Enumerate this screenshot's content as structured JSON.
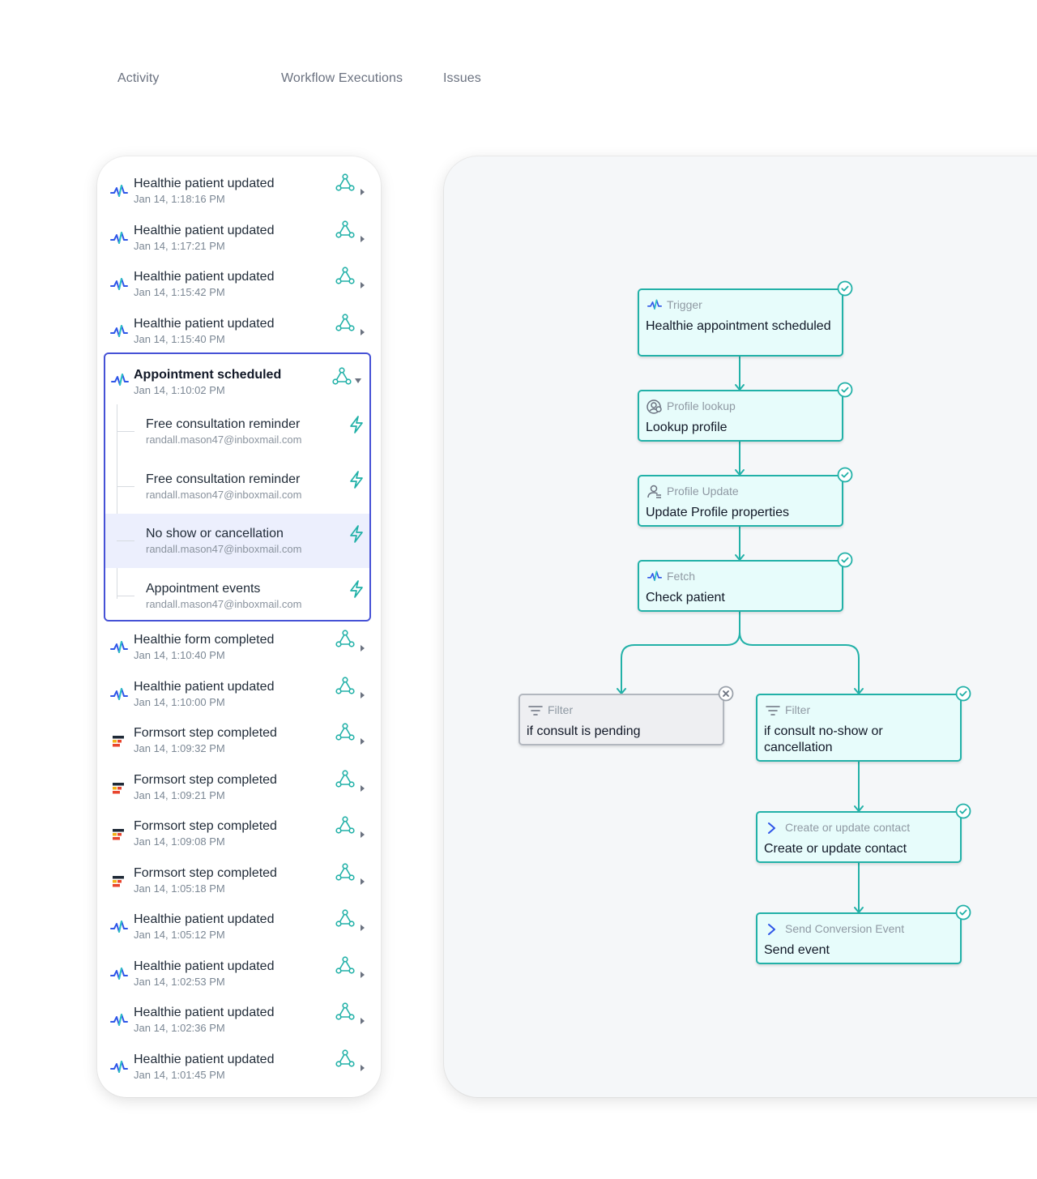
{
  "tabs": [
    {
      "label": "Activity"
    },
    {
      "label": "Workflow Executions"
    },
    {
      "label": "Issues"
    }
  ],
  "activity": {
    "top_items": [
      {
        "title": "Healthie patient updated",
        "time": "Jan 14, 1:18:16 PM",
        "source": "healthie"
      },
      {
        "title": "Healthie patient updated",
        "time": "Jan 14, 1:17:21 PM",
        "source": "healthie"
      },
      {
        "title": "Healthie patient updated",
        "time": "Jan 14, 1:15:42 PM",
        "source": "healthie"
      },
      {
        "title": "Healthie patient updated",
        "time": "Jan 14, 1:15:40 PM",
        "source": "healthie"
      }
    ],
    "expanded": {
      "title": "Appointment scheduled",
      "time": "Jan 14, 1:10:02 PM",
      "source": "healthie",
      "children": [
        {
          "title": "Free consultation reminder",
          "email": "randall.mason47@inboxmail.com",
          "selected": false
        },
        {
          "title": "Free consultation reminder",
          "email": "randall.mason47@inboxmail.com",
          "selected": false
        },
        {
          "title": "No show or cancellation",
          "email": "randall.mason47@inboxmail.com",
          "selected": true
        },
        {
          "title": "Appointment events",
          "email": "randall.mason47@inboxmail.com",
          "selected": false
        }
      ]
    },
    "bottom_items": [
      {
        "title": "Healthie form completed",
        "time": "Jan 14, 1:10:40 PM",
        "source": "healthie"
      },
      {
        "title": "Healthie patient updated",
        "time": "Jan 14, 1:10:00 PM",
        "source": "healthie"
      },
      {
        "title": "Formsort step completed",
        "time": "Jan 14, 1:09:32 PM",
        "source": "formsort"
      },
      {
        "title": "Formsort step completed",
        "time": "Jan 14, 1:09:21 PM",
        "source": "formsort"
      },
      {
        "title": "Formsort step completed",
        "time": "Jan 14, 1:09:08 PM",
        "source": "formsort"
      },
      {
        "title": "Formsort step completed",
        "time": "Jan 14, 1:05:18 PM",
        "source": "formsort"
      },
      {
        "title": "Healthie patient updated",
        "time": "Jan 14, 1:05:12 PM",
        "source": "healthie"
      },
      {
        "title": "Healthie patient updated",
        "time": "Jan 14, 1:02:53 PM",
        "source": "healthie"
      },
      {
        "title": "Healthie patient updated",
        "time": "Jan 14, 1:02:36 PM",
        "source": "healthie"
      },
      {
        "title": "Healthie patient updated",
        "time": "Jan 14, 1:01:45 PM",
        "source": "healthie"
      }
    ]
  },
  "workflow": {
    "nodes": {
      "trigger": {
        "type": "Trigger",
        "label": "Healthie appointment scheduled",
        "icon": "healthie-icon",
        "status": "success"
      },
      "lookup": {
        "type": "Profile lookup",
        "label": "Lookup profile",
        "icon": "profile-lookup-icon",
        "status": "success"
      },
      "update": {
        "type": "Profile Update",
        "label": "Update Profile properties",
        "icon": "profile-update-icon",
        "status": "success"
      },
      "fetch": {
        "type": "Fetch",
        "label": "Check patient",
        "icon": "healthie-icon",
        "status": "success"
      },
      "filter_pending": {
        "type": "Filter",
        "label": "if consult is pending",
        "icon": "filter-icon",
        "status": "failed"
      },
      "filter_noshow": {
        "type": "Filter",
        "label": "if consult no-show or cancellation",
        "icon": "filter-icon",
        "status": "success"
      },
      "contact": {
        "type": "Create or update contact",
        "label": "Create or update contact",
        "icon": "chevron-right-icon",
        "status": "success"
      },
      "send": {
        "type": "Send Conversion Event",
        "label": "Send event",
        "icon": "chevron-right-icon",
        "status": "success"
      }
    }
  },
  "colors": {
    "accent_teal": "#22b1a8",
    "selected_border": "#4652d6",
    "selected_bg": "#eceffd",
    "healthie_blue": "#2f56e8",
    "healthie_teal": "#2bc6c0"
  }
}
